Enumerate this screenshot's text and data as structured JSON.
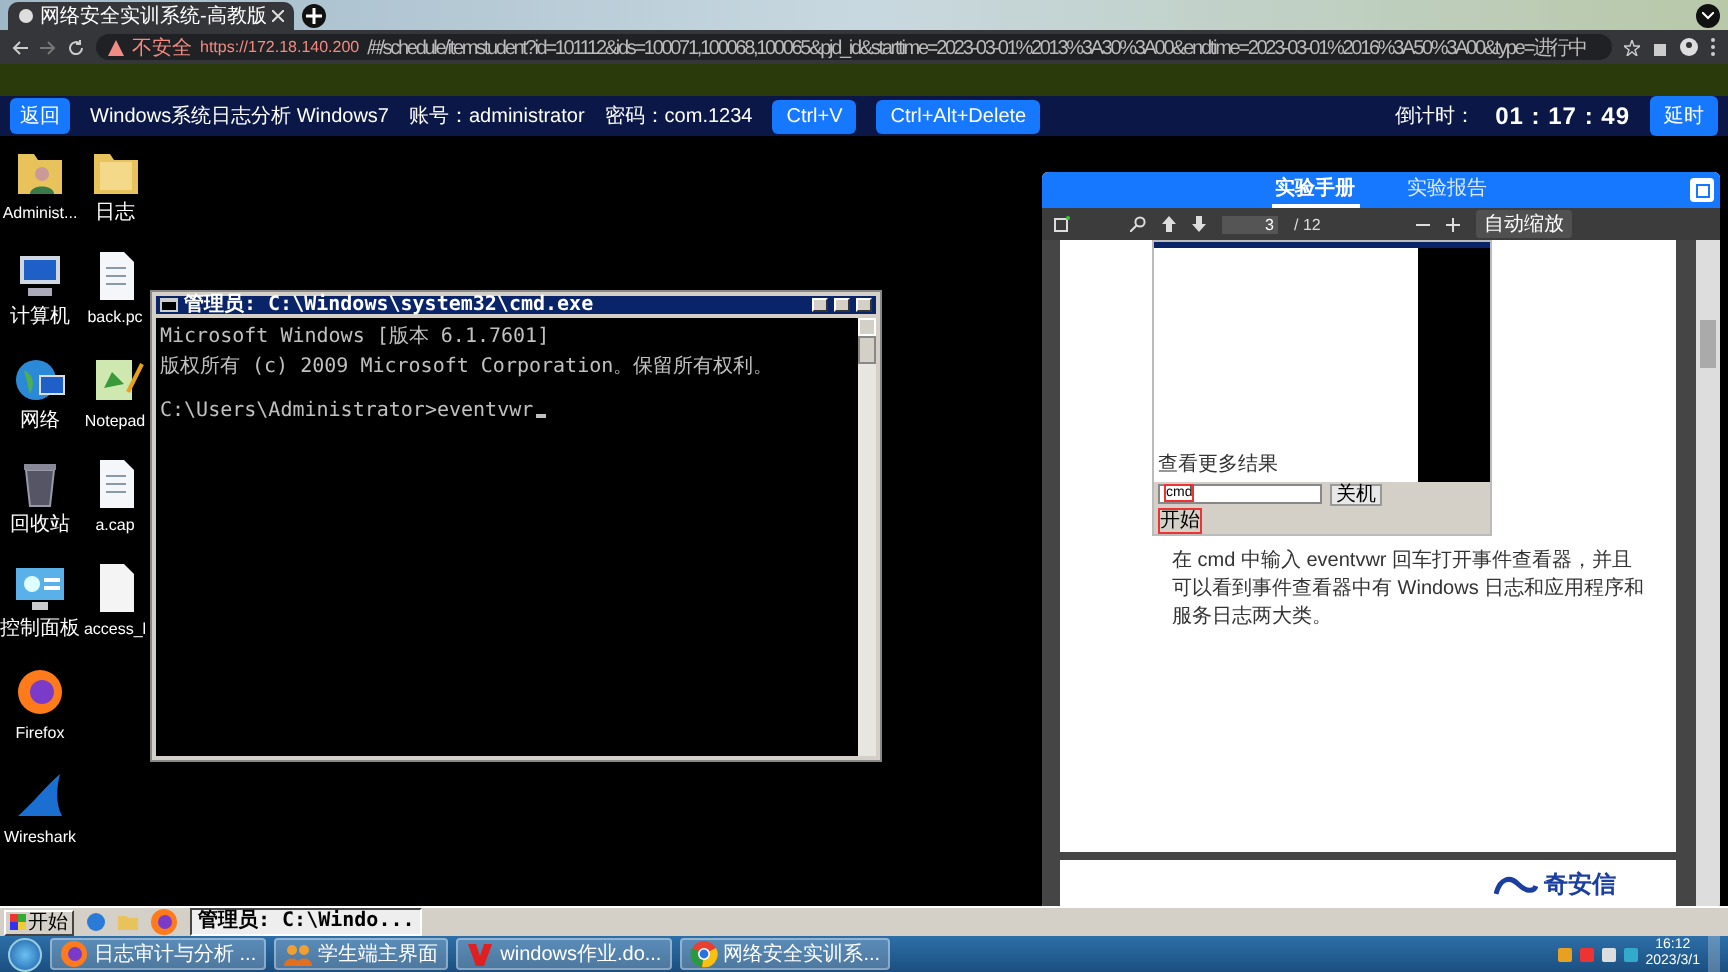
{
  "browser": {
    "tab": {
      "title": "网络安全实训系统-高教版",
      "selected": true
    },
    "security_label": "不安全",
    "url_host": "https://172.18.140.200",
    "url_path": "/#/schedule/itemstudent?id=101112&ids=100071,100068,100065&pjd_id&starttime=2023-03-01%2013%3A30%3A00&endtime=2023-03-01%2016%3A50%3A00&type=进行中"
  },
  "toolbar": {
    "back_button": "返回",
    "experiment": "Windows系统日志分析 Windows7",
    "account": "账号：administrator",
    "password": "密码：com.1234",
    "buttons": [
      "Ctrl+V",
      "Ctrl+Alt+Delete"
    ],
    "countdown_label": "倒计时：",
    "countdown": "01 : 17 : 49",
    "extend_button": "延时"
  },
  "desktop": {
    "icon_columns": [
      [
        {
          "label": "Administ...",
          "kind": "user-folder"
        },
        {
          "label": "计算机",
          "kind": "computer"
        },
        {
          "label": "网络",
          "kind": "network"
        },
        {
          "label": "回收站",
          "kind": "recycle-bin"
        },
        {
          "label": "控制面板",
          "kind": "control-panel"
        },
        {
          "label": "Firefox",
          "kind": "firefox"
        },
        {
          "label": "Wireshark",
          "kind": "wireshark"
        }
      ],
      [
        {
          "label": "日志",
          "kind": "folder"
        },
        {
          "label": "back.pc",
          "kind": "document"
        },
        {
          "label": "Notepad",
          "kind": "notepad"
        },
        {
          "label": "a.cap",
          "kind": "document"
        },
        {
          "label": "access_l",
          "kind": "blank-file"
        }
      ]
    ]
  },
  "cmd_window": {
    "title": "管理员: C:\\Windows\\system32\\cmd.exe",
    "lines": [
      "Microsoft Windows [版本 6.1.7601]",
      "版权所有 (c) 2009 Microsoft Corporation。保留所有权利。"
    ],
    "prompt": "C:\\Users\\Administrator>eventvwr"
  },
  "guide_panel": {
    "tabs": [
      {
        "label": "实验手册",
        "selected": true
      },
      {
        "label": "实验报告",
        "selected": false
      }
    ],
    "pdf_toolbar": {
      "page": "3",
      "page_count": "/ 12",
      "zoom": "自动缩放"
    },
    "page_figure": {
      "search_hint": "查看更多结果",
      "search_value": "cmd",
      "shutdown_button": "关机",
      "start_button": "开始"
    },
    "paragraph": "在 cmd 中输入 eventvwr 回车打开事件查看器，并且可以看到事件查看器中有 Windows 日志和应用程序和服务日志两大类。",
    "logo": "奇安信"
  },
  "vm_taskbar": {
    "start_button": "开始",
    "window_button": "管理员: C:\\Windo..."
  },
  "host_taskbar": {
    "items": [
      {
        "label": "日志审计与分析 ...",
        "kind": "firefox"
      },
      {
        "label": "学生端主界面",
        "kind": "people"
      },
      {
        "label": "windows作业.do...",
        "kind": "wps"
      },
      {
        "label": "网络安全实训系...",
        "kind": "chrome"
      }
    ],
    "clock": {
      "time": "16:12",
      "date": "2023/3/1"
    }
  }
}
